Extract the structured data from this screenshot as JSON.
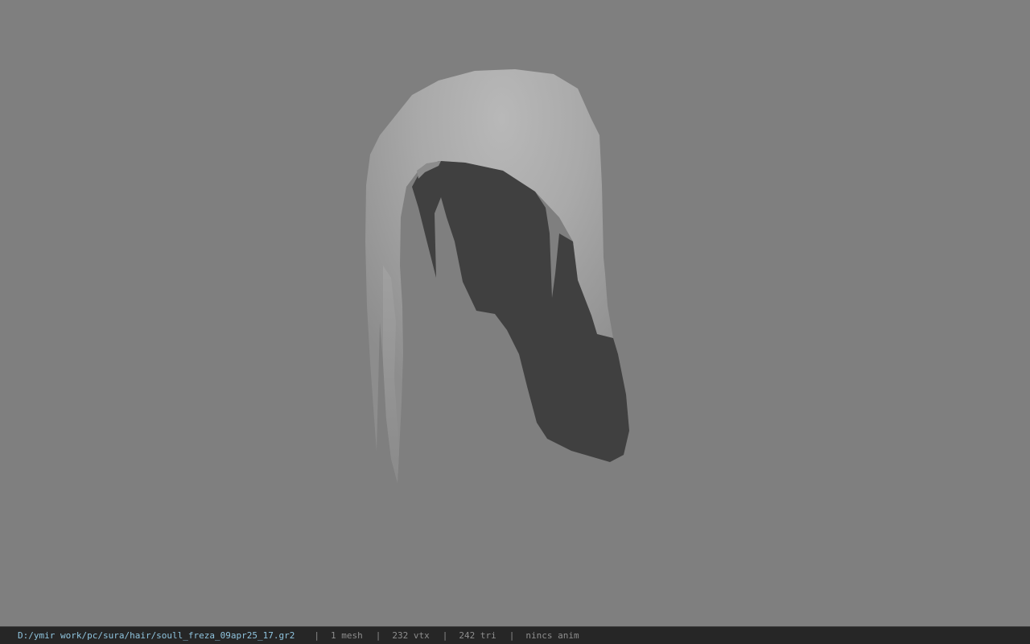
{
  "viewport": {
    "background": "#7f7f7f",
    "model": {
      "label": "hair mesh (untextured)",
      "outer_color": "#c8c8c8",
      "inner_color": "#404040"
    }
  },
  "status_bar": {
    "file_path": "D:/ymir work/pc/sura/hair/soull_freza_09apr25_17.gr2",
    "separator": "|",
    "mesh_count": "1 mesh",
    "vertex_count": "232 vtx",
    "triangle_count": "242 tri",
    "anim_status": "nincs anim",
    "path_color": "#8fc4de",
    "text_color": "#8e8e8e",
    "background": "#262626"
  }
}
